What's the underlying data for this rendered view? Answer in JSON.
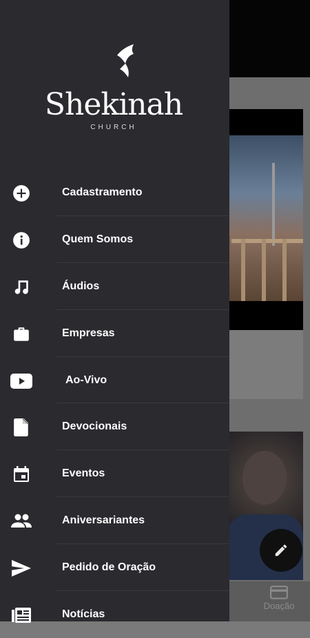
{
  "app": {
    "logo": {
      "name": "Shekinah",
      "sub": "CHURCH"
    }
  },
  "menu": {
    "items": [
      {
        "label": "Cadastramento",
        "icon": "add-circle-icon"
      },
      {
        "label": "Quem Somos",
        "icon": "info-icon"
      },
      {
        "label": "Áudios",
        "icon": "music-note-icon"
      },
      {
        "label": "Empresas",
        "icon": "briefcase-icon"
      },
      {
        "label": "Ao-Vivo",
        "icon": "youtube-icon"
      },
      {
        "label": "Devocionais",
        "icon": "document-icon"
      },
      {
        "label": "Eventos",
        "icon": "calendar-icon"
      },
      {
        "label": "Aniversariantes",
        "icon": "people-icon"
      },
      {
        "label": "Pedido de Oração",
        "icon": "send-icon"
      },
      {
        "label": "Notícias",
        "icon": "newspaper-icon"
      }
    ]
  },
  "bottom_nav": {
    "donate_label": "Doação",
    "donate_icon": "credit-card-icon"
  },
  "fab": {
    "icon": "pencil-icon"
  },
  "colors": {
    "drawer_bg": "#2b2a2f",
    "scrim": "#6e6e6e",
    "text": "#ffffff"
  }
}
